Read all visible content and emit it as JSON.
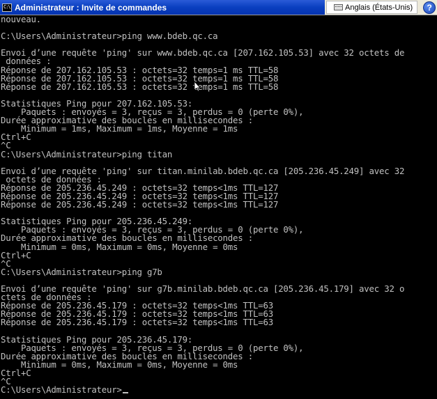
{
  "window": {
    "title": "Administrateur : Invite de commandes",
    "icon_label": "C:\\"
  },
  "language_bar": {
    "language": "Anglais (États-Unis)",
    "help": "?"
  },
  "console_lines": [
    "nouveau.",
    "",
    "C:\\Users\\Administrateur>ping www.bdeb.qc.ca",
    "",
    "Envoi d’une requête 'ping' sur www.bdeb.qc.ca [207.162.105.53] avec 32 octets de",
    " données :",
    "Réponse de 207.162.105.53 : octets=32 temps=1 ms TTL=58",
    "Réponse de 207.162.105.53 : octets=32 temps=1 ms TTL=58",
    "Réponse de 207.162.105.53 : octets=32 temps=1 ms TTL=58",
    "",
    "Statistiques Ping pour 207.162.105.53:",
    "    Paquets : envoyés = 3, reçus = 3, perdus = 0 (perte 0%),",
    "Durée approximative des boucles en millisecondes :",
    "    Minimum = 1ms, Maximum = 1ms, Moyenne = 1ms",
    "Ctrl+C",
    "^C",
    "C:\\Users\\Administrateur>ping titan",
    "",
    "Envoi d’une requête 'ping' sur titan.minilab.bdeb.qc.ca [205.236.45.249] avec 32",
    " octets de données :",
    "Réponse de 205.236.45.249 : octets=32 temps<1ms TTL=127",
    "Réponse de 205.236.45.249 : octets=32 temps<1ms TTL=127",
    "Réponse de 205.236.45.249 : octets=32 temps<1ms TTL=127",
    "",
    "Statistiques Ping pour 205.236.45.249:",
    "    Paquets : envoyés = 3, reçus = 3, perdus = 0 (perte 0%),",
    "Durée approximative des boucles en millisecondes :",
    "    Minimum = 0ms, Maximum = 0ms, Moyenne = 0ms",
    "Ctrl+C",
    "^C",
    "C:\\Users\\Administrateur>ping g7b",
    "",
    "Envoi d’une requête 'ping' sur g7b.minilab.bdeb.qc.ca [205.236.45.179] avec 32 o",
    "ctets de données :",
    "Réponse de 205.236.45.179 : octets=32 temps<1ms TTL=63",
    "Réponse de 205.236.45.179 : octets=32 temps<1ms TTL=63",
    "Réponse de 205.236.45.179 : octets=32 temps<1ms TTL=63",
    "",
    "Statistiques Ping pour 205.236.45.179:",
    "    Paquets : envoyés = 3, reçus = 3, perdus = 0 (perte 0%),",
    "Durée approximative des boucles en millisecondes :",
    "    Minimum = 0ms, Maximum = 0ms, Moyenne = 0ms",
    "Ctrl+C",
    "^C",
    "C:\\Users\\Administrateur>"
  ],
  "colors": {
    "console_background": "#000000",
    "console_text": "#c0c0c0",
    "title_bar": "#0a3fc0",
    "title_text": "#ffffff"
  },
  "icons": {
    "app": "cmd-icon",
    "keyboard": "keyboard-icon",
    "help": "help-icon",
    "pointer": "mouse-pointer-icon"
  }
}
